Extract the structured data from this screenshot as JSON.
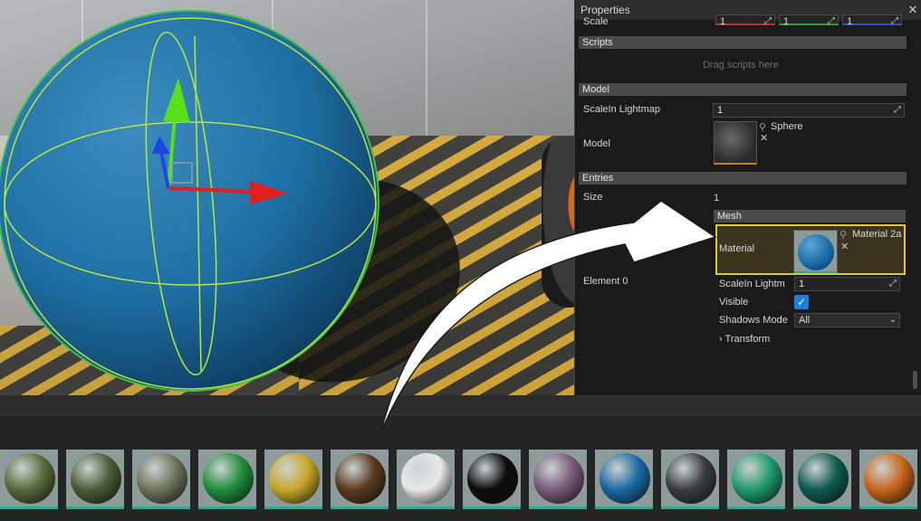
{
  "properties": {
    "title": "Properties",
    "close_glyph": "✕",
    "scale_label": "Scale",
    "scale_values": [
      "1",
      "1",
      "1"
    ],
    "scripts_header": "Scripts",
    "scripts_drop_hint": "Drag scripts here",
    "model_header": "Model",
    "scale_in_lightmap_label": "ScaleIn Lightmap",
    "scale_in_lightmap_value": "1",
    "model_label": "Model",
    "model_asset_name": "Sphere",
    "entries_header": "Entries",
    "size_label": "Size",
    "size_value": "1",
    "element_label": "Element 0",
    "mesh_header": "Mesh",
    "material_label": "Material",
    "material_asset_name": "Material 2a",
    "mesh_scale_in_lightmap_label": "ScaleIn Lightm",
    "mesh_scale_in_lightmap_value": "1",
    "visible_label": "Visible",
    "visible_checked": true,
    "shadows_mode_label": "Shadows Mode",
    "shadows_mode_value": "All",
    "transform_label": "Transform",
    "highlight_color": "#e6c62e"
  },
  "asset_bar": {
    "items": [
      {
        "name": "camo-material-1",
        "color": "#5a6a3a"
      },
      {
        "name": "camo-material-2",
        "color": "#4b5d35"
      },
      {
        "name": "camo-material-3",
        "color": "#6d745b"
      },
      {
        "name": "green-gloss-material",
        "color": "#1f8f3a"
      },
      {
        "name": "gold-material",
        "color": "#c8a82a"
      },
      {
        "name": "rusty-green-material",
        "color": "#5a3a20"
      },
      {
        "name": "white-material",
        "color": "#e8e8e8"
      },
      {
        "name": "black-material",
        "color": "#0c0c0c"
      },
      {
        "name": "iridescent-material",
        "color": "#7a5a7a"
      },
      {
        "name": "blue-material",
        "color": "#1a6aa5"
      },
      {
        "name": "dark-metal-material",
        "color": "#3a3d3f"
      },
      {
        "name": "teal-material",
        "color": "#1f9a6e"
      },
      {
        "name": "dark-teal-material",
        "color": "#0f5a50"
      },
      {
        "name": "orange-material",
        "color": "#c8641a"
      }
    ]
  },
  "colors": {
    "sphere": "#1e6fa3",
    "gizmo_x": "#e21e1e",
    "gizmo_y": "#59e01a",
    "gizmo_z": "#1e46e2",
    "wireframe": "#b8e83a"
  }
}
